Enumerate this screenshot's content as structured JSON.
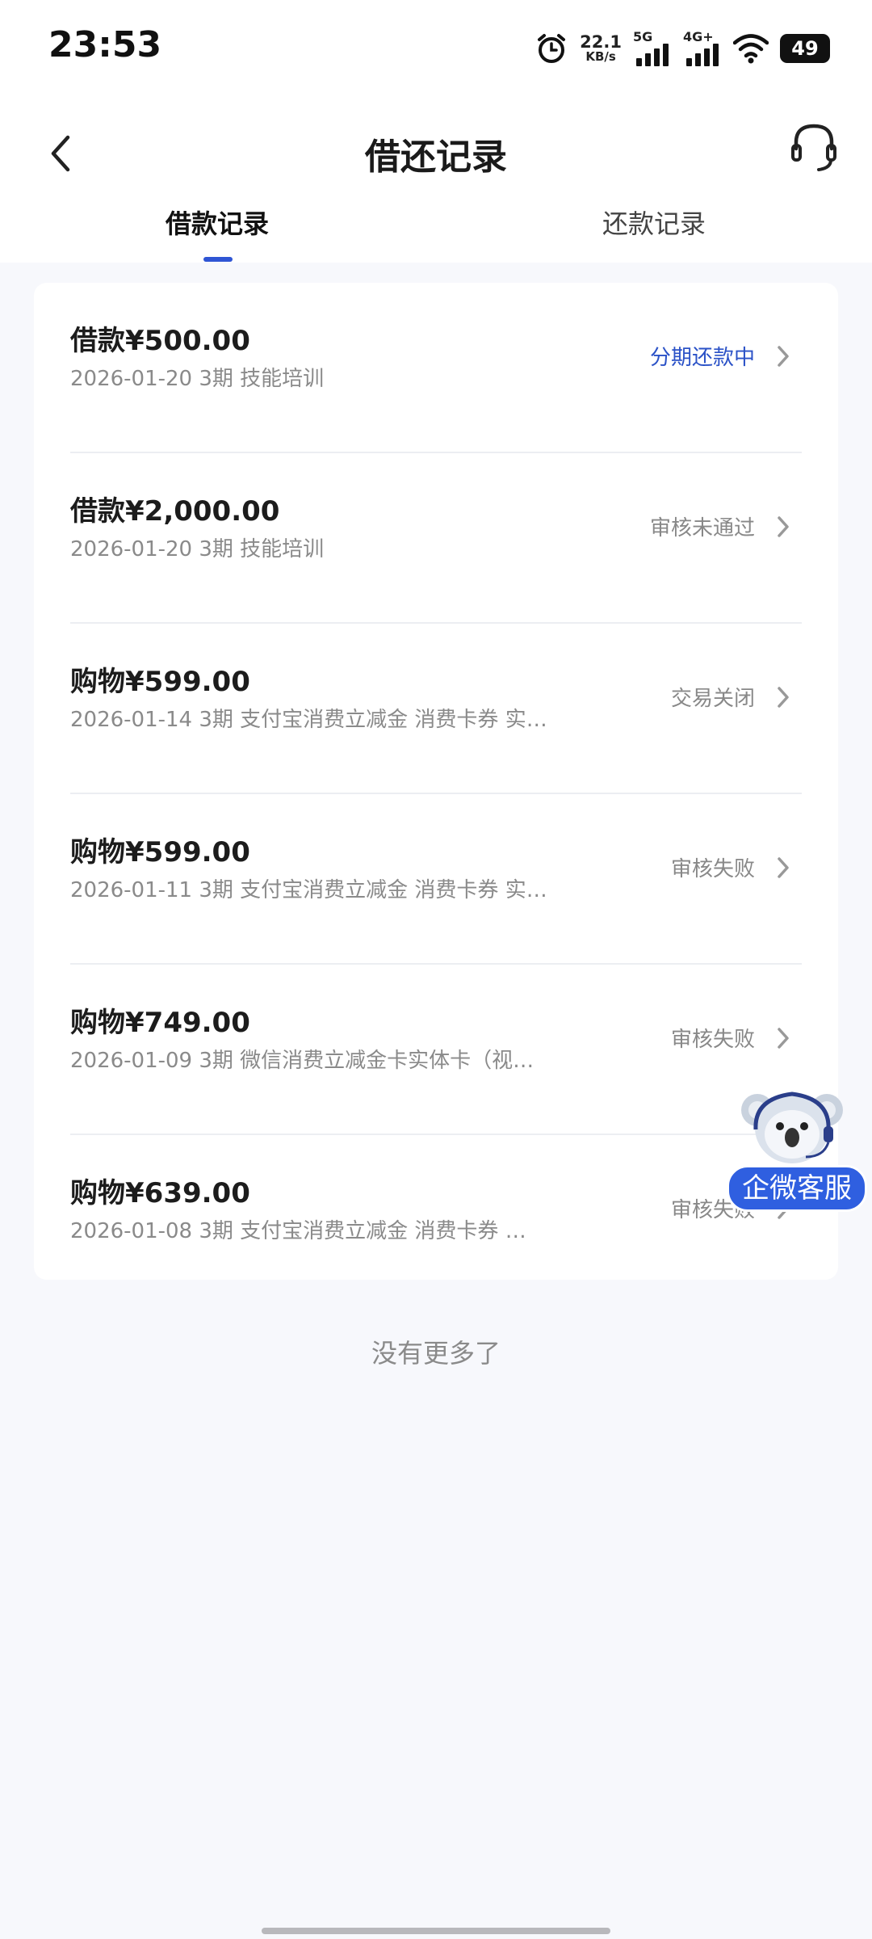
{
  "status_bar": {
    "time": "23:53",
    "net_speed": "22.1",
    "net_speed_unit": "KB/s",
    "sim1_label": "5G",
    "sim2_label": "4G+",
    "battery": "49"
  },
  "header": {
    "title": "借还记录",
    "tabs": [
      {
        "label": "借款记录",
        "active": true
      },
      {
        "label": "还款记录",
        "active": false
      }
    ]
  },
  "records": [
    {
      "amount": "借款¥500.00",
      "desc": "2026-01-20 3期  技能培训",
      "status": "分期还款中",
      "status_color": "#2b52c7"
    },
    {
      "amount": "借款¥2,000.00",
      "desc": "2026-01-20 3期  技能培训",
      "status": "审核未通过",
      "status_color": "#888888"
    },
    {
      "amount": "购物¥599.00",
      "desc": "2026-01-14 3期  支付宝消费立减金 消费卡券 实…",
      "status": "交易关闭",
      "status_color": "#888888"
    },
    {
      "amount": "购物¥599.00",
      "desc": "2026-01-11 3期  支付宝消费立减金 消费卡券 实…",
      "status": "审核失败",
      "status_color": "#888888"
    },
    {
      "amount": "购物¥749.00",
      "desc": "2026-01-09 3期  微信消费立减金卡实体卡（视…",
      "status": "审核失败",
      "status_color": "#888888"
    },
    {
      "amount": "购物¥639.00",
      "desc": "2026-01-08 3期  支付宝消费立减金 消费卡券 …",
      "status": "审核失败",
      "status_color": "#888888"
    }
  ],
  "footer": {
    "no_more": "没有更多了"
  },
  "floating_service": {
    "label": "企微客服"
  },
  "colors": {
    "accent": "#2f55d4",
    "background": "#f7f8fc",
    "float_button": "#2f5fe0"
  },
  "icons": {
    "back": "chevron-left-icon",
    "support": "headset-icon",
    "row_arrow": "chevron-right-icon",
    "mascot": "koala-mascot-icon"
  }
}
